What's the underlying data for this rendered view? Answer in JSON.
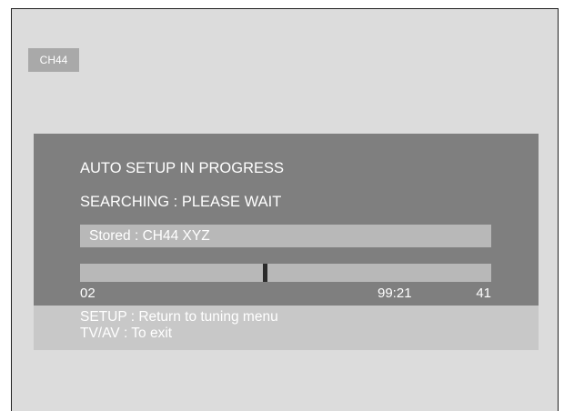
{
  "channel_badge": "CH44",
  "panel": {
    "title": "AUTO SETUP IN PROGRESS",
    "status": "SEARCHING : PLEASE WAIT",
    "stored": "Stored : CH44 XYZ",
    "progress": {
      "fraction": 0.45,
      "start_label": "02",
      "time_label": "99:21",
      "end_label": "41"
    }
  },
  "help": {
    "line1": "SETUP : Return to tuning menu",
    "line2": "TV/AV : To exit"
  }
}
